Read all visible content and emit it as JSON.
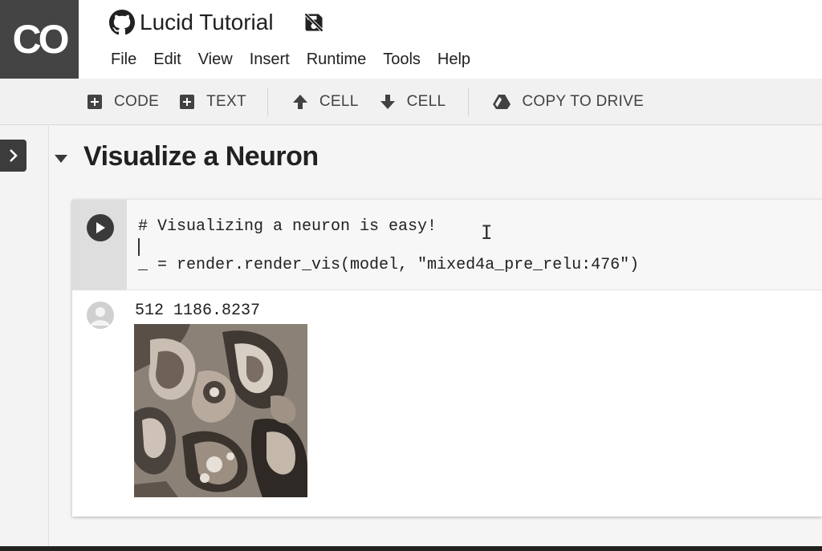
{
  "logo": {
    "text": "CO"
  },
  "header": {
    "title": "Lucid Tutorial",
    "menu": [
      "File",
      "Edit",
      "View",
      "Insert",
      "Runtime",
      "Tools",
      "Help"
    ]
  },
  "toolbar": {
    "add_code": "CODE",
    "add_text": "TEXT",
    "cell_up": "CELL",
    "cell_down": "CELL",
    "copy_to_drive": "COPY TO DRIVE"
  },
  "section": {
    "title": "Visualize a Neuron"
  },
  "cell": {
    "code_lines": [
      "# Visualizing a neuron is easy!",
      "",
      "_ = render.render_vis(model, \"mixed4a_pre_relu:476\")"
    ],
    "output_text": "512 1186.8237"
  },
  "colors": {
    "logo_bg": "#444444",
    "run_button": "#3a3a3a",
    "gutter": "#dedede"
  },
  "icons": {
    "title": "github-icon",
    "save_status": "no-save-icon",
    "add_code": "plus-box-icon",
    "add_text": "plus-box-icon",
    "move_up": "arrow-up-icon",
    "move_down": "arrow-down-icon",
    "drive": "google-drive-icon",
    "sidebar": "chevron-right-icon",
    "section": "caret-down-icon",
    "run": "play-icon",
    "output": "avatar-icon"
  }
}
